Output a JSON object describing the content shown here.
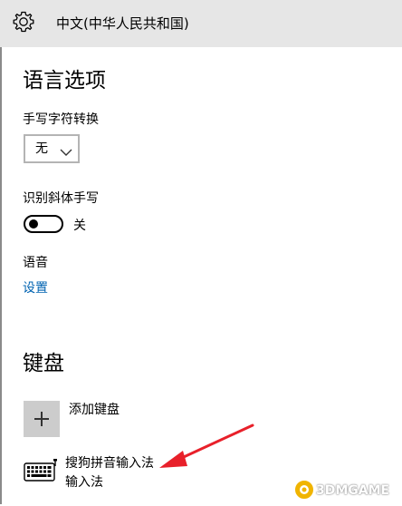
{
  "header": {
    "title": "中文(中华人民共和国)",
    "settings_icon": "gear-icon",
    "background": "#e6e6e6"
  },
  "language_options": {
    "heading": "语言选项",
    "handwriting_conversion": {
      "label": "手写字符转换",
      "selected": "无",
      "dropdown_icon": "chevron-down-icon"
    },
    "italic_handwriting": {
      "label": "识别斜体手写",
      "state_label": "关",
      "on": false
    },
    "speech": {
      "label": "语音",
      "link": "设置",
      "link_color": "#0063b1"
    }
  },
  "keyboard": {
    "heading": "键盘",
    "add_keyboard_label": "添加键盘",
    "add_icon": "plus-icon",
    "items": [
      {
        "name": "搜狗拼音输入法",
        "subtitle": "输入法",
        "icon": "keyboard-icon"
      }
    ]
  },
  "annotation": {
    "arrow_color": "#e8202a"
  },
  "watermark": {
    "text": "3DMGAME"
  }
}
